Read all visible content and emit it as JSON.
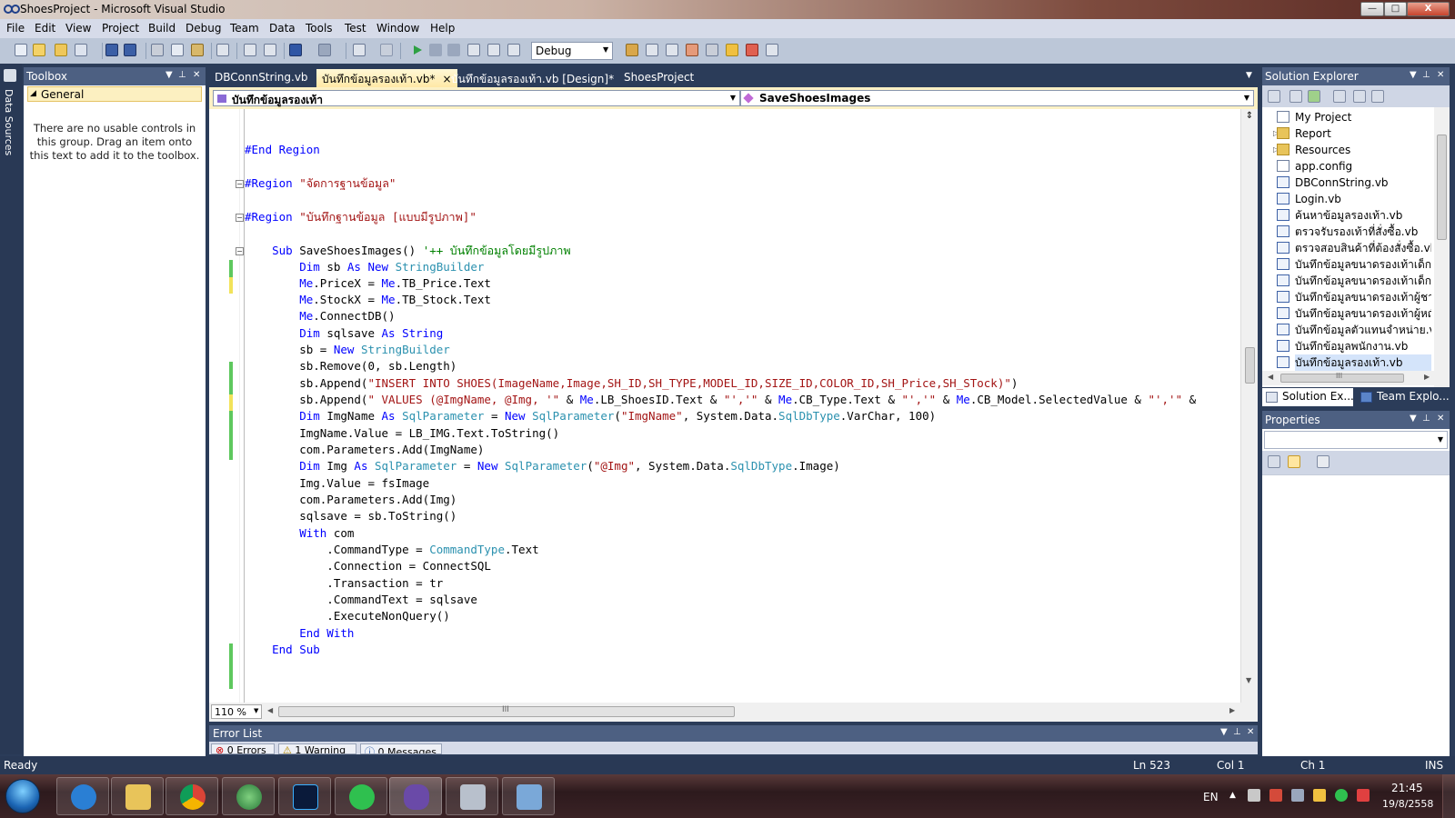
{
  "window": {
    "title": "ShoesProject - Microsoft Visual Studio",
    "minimize": "—",
    "maximize": "□",
    "close": "X"
  },
  "menu": [
    "File",
    "Edit",
    "View",
    "Project",
    "Build",
    "Debug",
    "Team",
    "Data",
    "Tools",
    "Test",
    "Window",
    "Help"
  ],
  "toolbar": {
    "configuration": "Debug"
  },
  "left_strip": {
    "label": "Data Sources"
  },
  "toolbox": {
    "title": "Toolbox",
    "group": "General",
    "empty_message": "There are no usable controls in this group. Drag an item onto this text to add it to the toolbox."
  },
  "tabs": [
    {
      "label": "DBConnString.vb"
    },
    {
      "label": "บันทึกข้อมูลรองเท้า.vb*"
    },
    {
      "label": "บันทึกข้อมูลรองเท้า.vb [Design]*"
    },
    {
      "label": "ShoesProject"
    }
  ],
  "tab_close": "×",
  "nav": {
    "left": "บันทึกข้อมูลรองเท้า",
    "right": "SaveShoesImages"
  },
  "code": {
    "l1": [
      "#End Region"
    ],
    "l2": [
      "#Region ",
      "\"จัดการฐานข้อมูล\""
    ],
    "l3": [
      "#Region ",
      "\"บันทึกฐานข้อมูล [แบบมีรูปภาพ]\""
    ],
    "l4": [
      "    Sub ",
      "SaveShoesImages() ",
      "'++ บันทึกข้อมูลโดยมีรูปภาพ"
    ],
    "l5": [
      "        Dim ",
      "sb ",
      "As New ",
      "StringBuilder"
    ],
    "l6": [
      "        Me",
      ".PriceX = ",
      "Me",
      ".TB_Price.Text"
    ],
    "l7": [
      "        Me",
      ".StockX = ",
      "Me",
      ".TB_Stock.Text"
    ],
    "l8": [
      "        Me",
      ".ConnectDB()"
    ],
    "l9": [
      "        Dim ",
      "sqlsave ",
      "As String"
    ],
    "l10": [
      "        sb = ",
      "New ",
      "StringBuilder"
    ],
    "l11": [
      "        sb.Remove(0, sb.Length)"
    ],
    "l12": [
      "        sb.Append(",
      "\"INSERT INTO SHOES(ImageName,Image,SH_ID,SH_TYPE,MODEL_ID,SIZE_ID,COLOR_ID,SH_Price,SH_STock)\"",
      ")"
    ],
    "l13": [
      "        sb.Append(",
      "\" VALUES (@ImgName, @Img, '\"",
      " & ",
      "Me",
      ".LB_ShoesID.Text & ",
      "\"','\"",
      " & ",
      "Me",
      ".CB_Type.Text & ",
      "\"','\"",
      " & ",
      "Me",
      ".CB_Model.SelectedValue & ",
      "\"','\"",
      " &"
    ],
    "l14": [
      "        Dim ",
      "ImgName ",
      "As ",
      "SqlParameter",
      " = ",
      "New ",
      "SqlParameter",
      "(",
      "\"ImgName\"",
      ", System.Data.",
      "SqlDbType",
      ".VarChar, 100)"
    ],
    "l15": [
      "        ImgName.Value = LB_IMG.Text.ToString()"
    ],
    "l16": [
      "        com.Parameters.Add(ImgName)"
    ],
    "l17": [
      "        Dim ",
      "Img ",
      "As ",
      "SqlParameter",
      " = ",
      "New ",
      "SqlParameter",
      "(",
      "\"@Img\"",
      ", System.Data.",
      "SqlDbType",
      ".Image)"
    ],
    "l18": [
      "        Img.Value = fsImage"
    ],
    "l19": [
      "        com.Parameters.Add(Img)"
    ],
    "l20": [
      "        sqlsave = sb.ToString()"
    ],
    "l21": [
      "        With ",
      "com"
    ],
    "l22": [
      "            .CommandType = ",
      "CommandType",
      ".Text"
    ],
    "l23": [
      "            .Connection = ConnectSQL"
    ],
    "l24": [
      "            .Transaction = tr"
    ],
    "l25": [
      "            .CommandText = sqlsave"
    ],
    "l26": [
      "            .ExecuteNonQuery()"
    ],
    "l27": [
      "        End With"
    ],
    "l28": [
      "    End Sub"
    ]
  },
  "editor": {
    "zoom": "110 %",
    "scroll_grip": "III"
  },
  "error_list": {
    "title": "Error List",
    "errors": "0 Errors",
    "warnings": "1 Warning",
    "messages": "0 Messages"
  },
  "solution_explorer": {
    "title": "Solution Explorer",
    "items": [
      {
        "label": "My Project",
        "icon": "my-project-icon"
      },
      {
        "label": "Report",
        "icon": "folder-icon"
      },
      {
        "label": "Resources",
        "icon": "folder-icon"
      },
      {
        "label": "app.config",
        "icon": "config-file-icon"
      },
      {
        "label": "DBConnString.vb",
        "icon": "vb-file-icon"
      },
      {
        "label": "Login.vb",
        "icon": "vb-form-icon"
      },
      {
        "label": "ค้นหาข้อมูลรองเท้า.vb",
        "icon": "vb-form-icon"
      },
      {
        "label": "ตรวจรับรองเท้าที่สั่งซื้อ.vb",
        "icon": "vb-form-icon"
      },
      {
        "label": "ตรวจสอบสินค้าที่ต้องสั่งซื้อ.vb",
        "icon": "vb-form-icon"
      },
      {
        "label": "บันทึกข้อมูลขนาดรองเท้าเด็ก",
        "icon": "vb-form-icon"
      },
      {
        "label": "บันทึกข้อมูลขนาดรองเท้าเด็ก",
        "icon": "vb-form-icon"
      },
      {
        "label": "บันทึกข้อมูลขนาดรองเท้าผู้ชา",
        "icon": "vb-form-icon"
      },
      {
        "label": "บันทึกข้อมูลขนาดรองเท้าผู้หญิ",
        "icon": "vb-form-icon"
      },
      {
        "label": "บันทึกข้อมูลตัวแทนจำหน่าย.v",
        "icon": "vb-form-icon"
      },
      {
        "label": "บันทึกข้อมูลพนักงาน.vb",
        "icon": "vb-form-icon"
      },
      {
        "label": "บันทึกข้อมูลรองเท้า.vb",
        "icon": "vb-form-icon"
      }
    ],
    "scroll_grip": "III"
  },
  "panel_tabs": {
    "solution": "Solution Ex...",
    "team": "Team Explo..."
  },
  "properties": {
    "title": "Properties"
  },
  "status": {
    "ready": "Ready",
    "line": "Ln 523",
    "col": "Col 1",
    "ch": "Ch 1",
    "ins": "INS"
  },
  "taskbar": {
    "lang": "EN",
    "time": "21:45",
    "date": "19/8/2558"
  },
  "colors": {
    "keyword": "#0000ff",
    "string": "#a31515",
    "comment": "#008000",
    "type": "#2b91af",
    "changed_saved": "#5ec85e",
    "changed_unsaved": "#f2e35a"
  }
}
